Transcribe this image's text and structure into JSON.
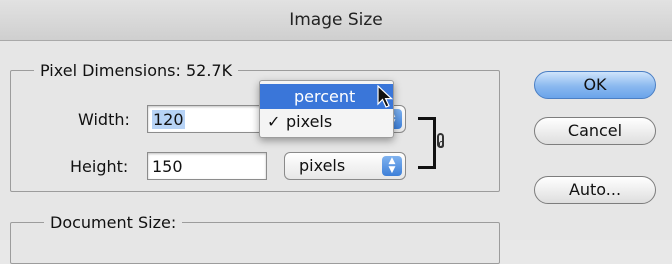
{
  "window": {
    "title": "Image Size"
  },
  "pixel_dimensions": {
    "label": "Pixel Dimensions:",
    "size_value": "52.7K",
    "width_label": "Width:",
    "width_value": "120",
    "height_label": "Height:",
    "height_value": "150",
    "width_unit": "pixels",
    "height_unit": "pixels"
  },
  "unit_menu": {
    "items": [
      {
        "label": "percent",
        "checked": false,
        "highlighted": true
      },
      {
        "label": "pixels",
        "checked": true,
        "check_mark": "✓",
        "highlighted": false
      }
    ]
  },
  "document_size": {
    "label": "Document Size:"
  },
  "buttons": {
    "ok": "OK",
    "cancel": "Cancel",
    "auto": "Auto..."
  },
  "colors": {
    "menu_highlight": "#3a76d9",
    "default_button": "#8ab8ef",
    "selection": "#b7d3f6"
  }
}
